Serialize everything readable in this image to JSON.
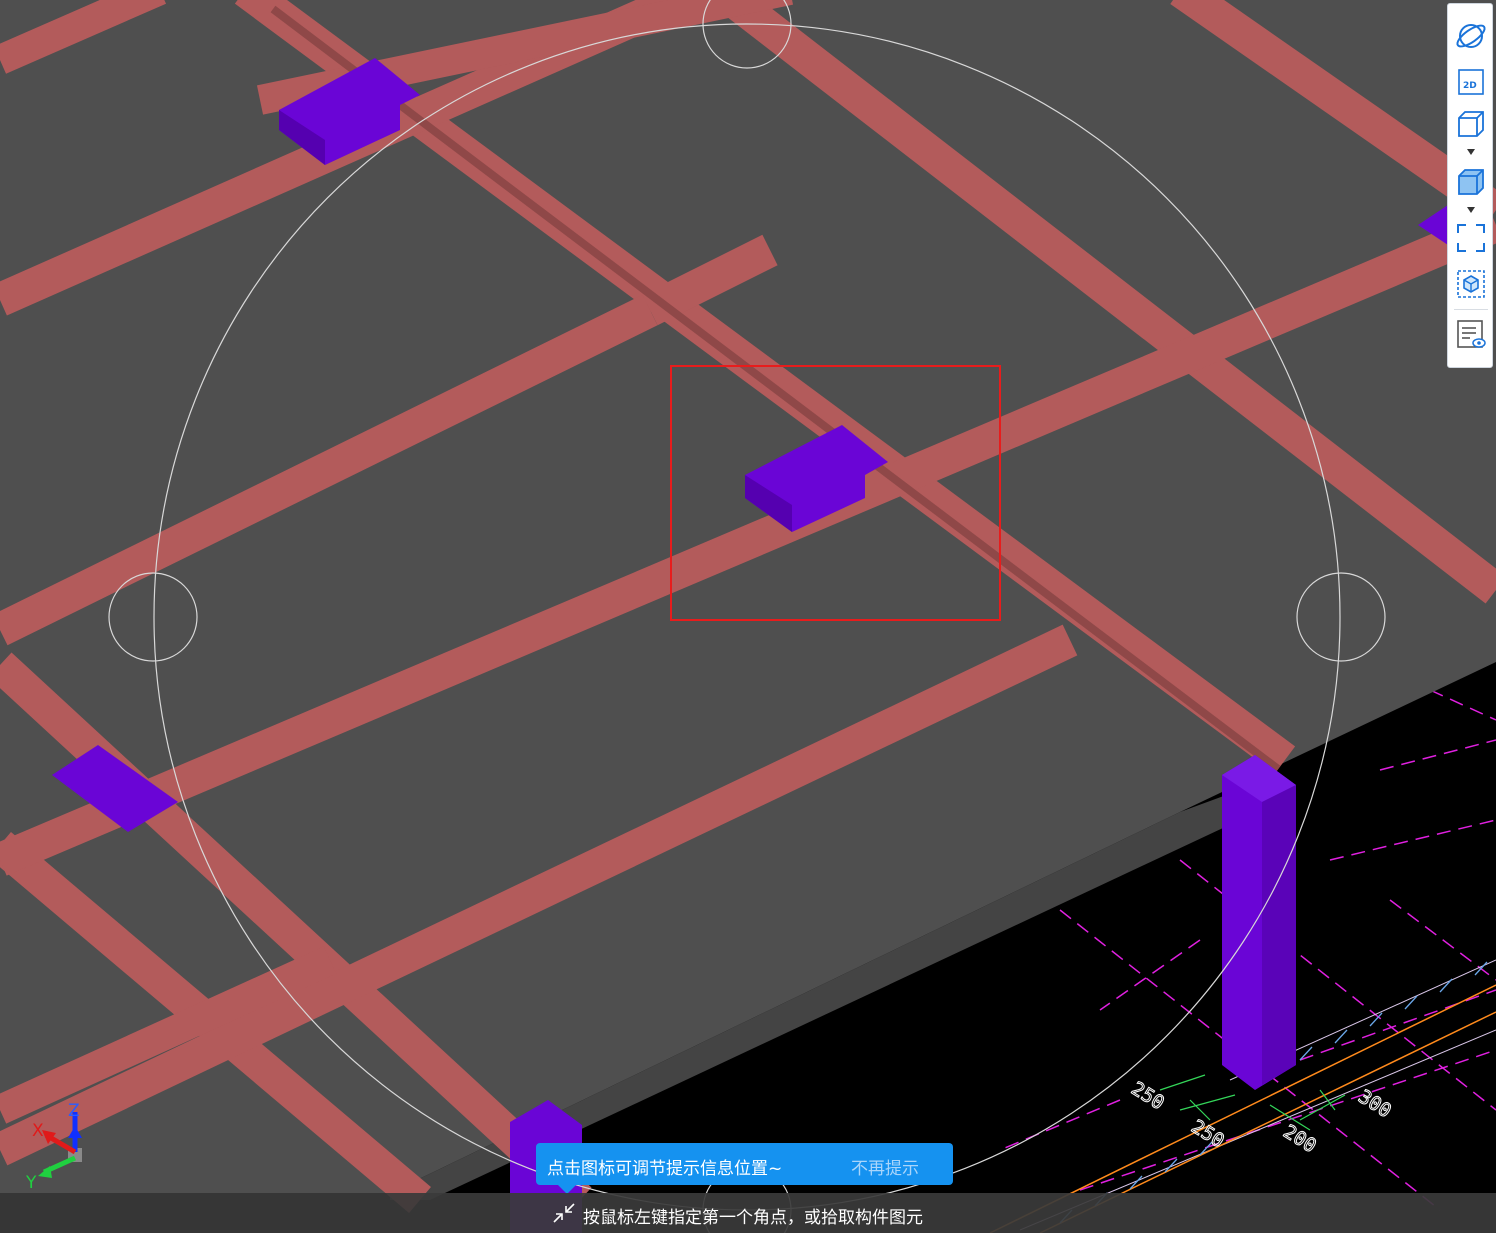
{
  "viewport": {
    "colors": {
      "slab": "#4f4f4f",
      "beam": "#b35b5b",
      "beam_side": "#9a4d4d",
      "column": "#6a05d6",
      "background": "#000000",
      "axis_line": "#e020e0",
      "selection_box": "#e81c1c",
      "orbit_guide": "#d8d8d8"
    },
    "dimensions": [
      "250",
      "250",
      "200",
      "300"
    ]
  },
  "toolbar": {
    "items": [
      {
        "name": "orbit-icon"
      },
      {
        "name": "view-2d-icon",
        "label": "2D"
      },
      {
        "name": "view-3d-wireframe-icon"
      },
      {
        "name": "view-3d-solid-icon"
      },
      {
        "name": "fit-view-icon"
      },
      {
        "name": "component-view-icon"
      },
      {
        "name": "properties-view-icon"
      }
    ]
  },
  "tip": {
    "message": "点击图标可调节提示信息位置~",
    "dismiss": "不再提示"
  },
  "status": {
    "message": "按鼠标左键指定第一个角点，或拾取构件图元"
  },
  "axes": {
    "x": "X",
    "y": "Y",
    "z": "Z"
  }
}
